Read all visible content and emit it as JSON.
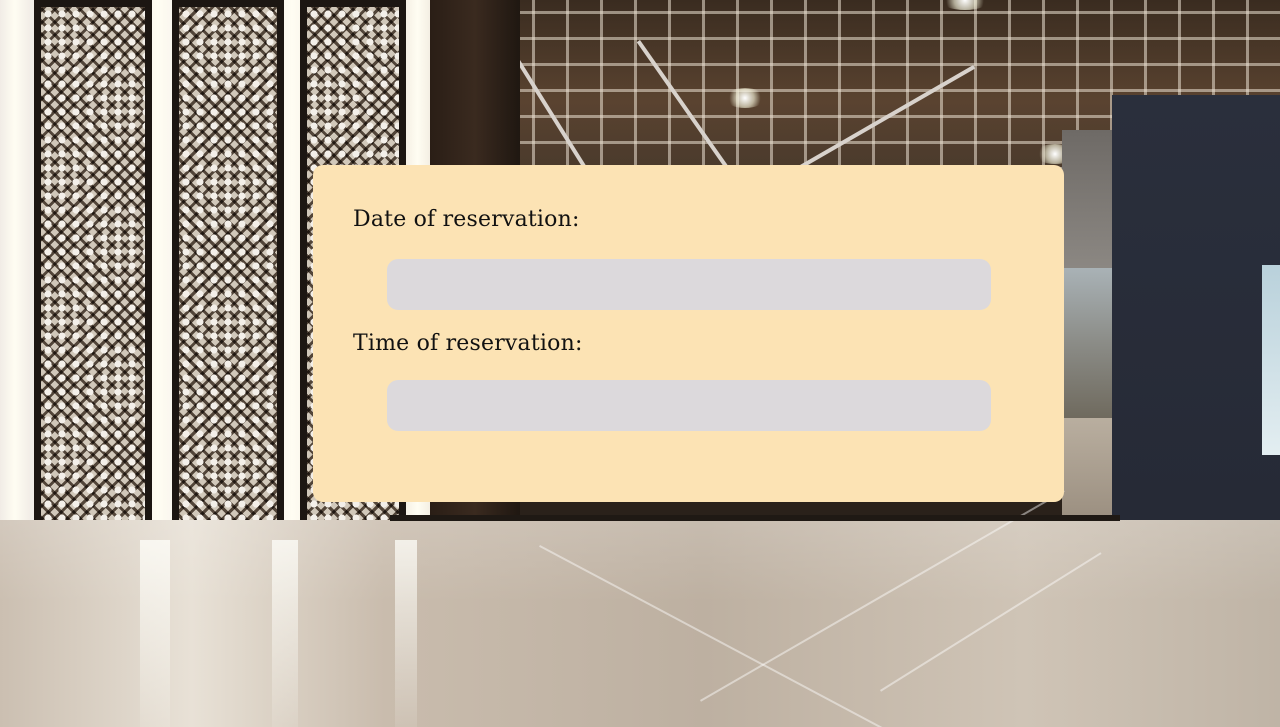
{
  "reservation_form": {
    "date_label": "Date of reservation:",
    "date_value": "",
    "time_label": "Time of reservation:",
    "time_value": ""
  },
  "colors": {
    "card_background": "#fce3b4",
    "input_background": "#dcd9dc",
    "label_text": "#111111"
  }
}
